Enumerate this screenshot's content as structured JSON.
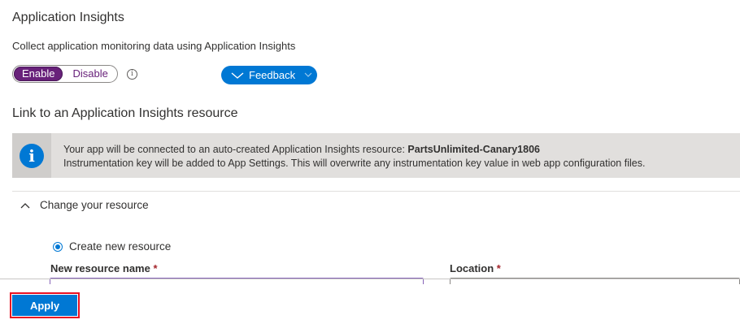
{
  "app_insights": {
    "title": "Application Insights",
    "description": "Collect application monitoring data using Application Insights",
    "toggle": {
      "enable_label": "Enable",
      "disable_label": "Disable",
      "selected": "Enable"
    },
    "info_glyph": "i",
    "feedback_label": "Feedback"
  },
  "link_section": {
    "title": "Link to an Application Insights resource",
    "banner": {
      "icon_glyph": "i",
      "line1_prefix": "Your app will be connected to an auto-created Application Insights resource: ",
      "resource_name": "PartsUnlimited-Canary1806",
      "line2": "Instrumentation key will be added to App Settings. This will overwrite any instrumentation key value in web app configuration files."
    },
    "expander_label": "Change your resource",
    "radio_label": "Create new resource",
    "new_resource_label": "New resource name",
    "location_label": "Location",
    "required_marker": "*"
  },
  "footer": {
    "apply_label": "Apply"
  },
  "colors": {
    "accent": "#0078d4",
    "toggle_selected": "#68217a",
    "banner_bg": "#e1dfdd",
    "highlight": "#e81123"
  }
}
